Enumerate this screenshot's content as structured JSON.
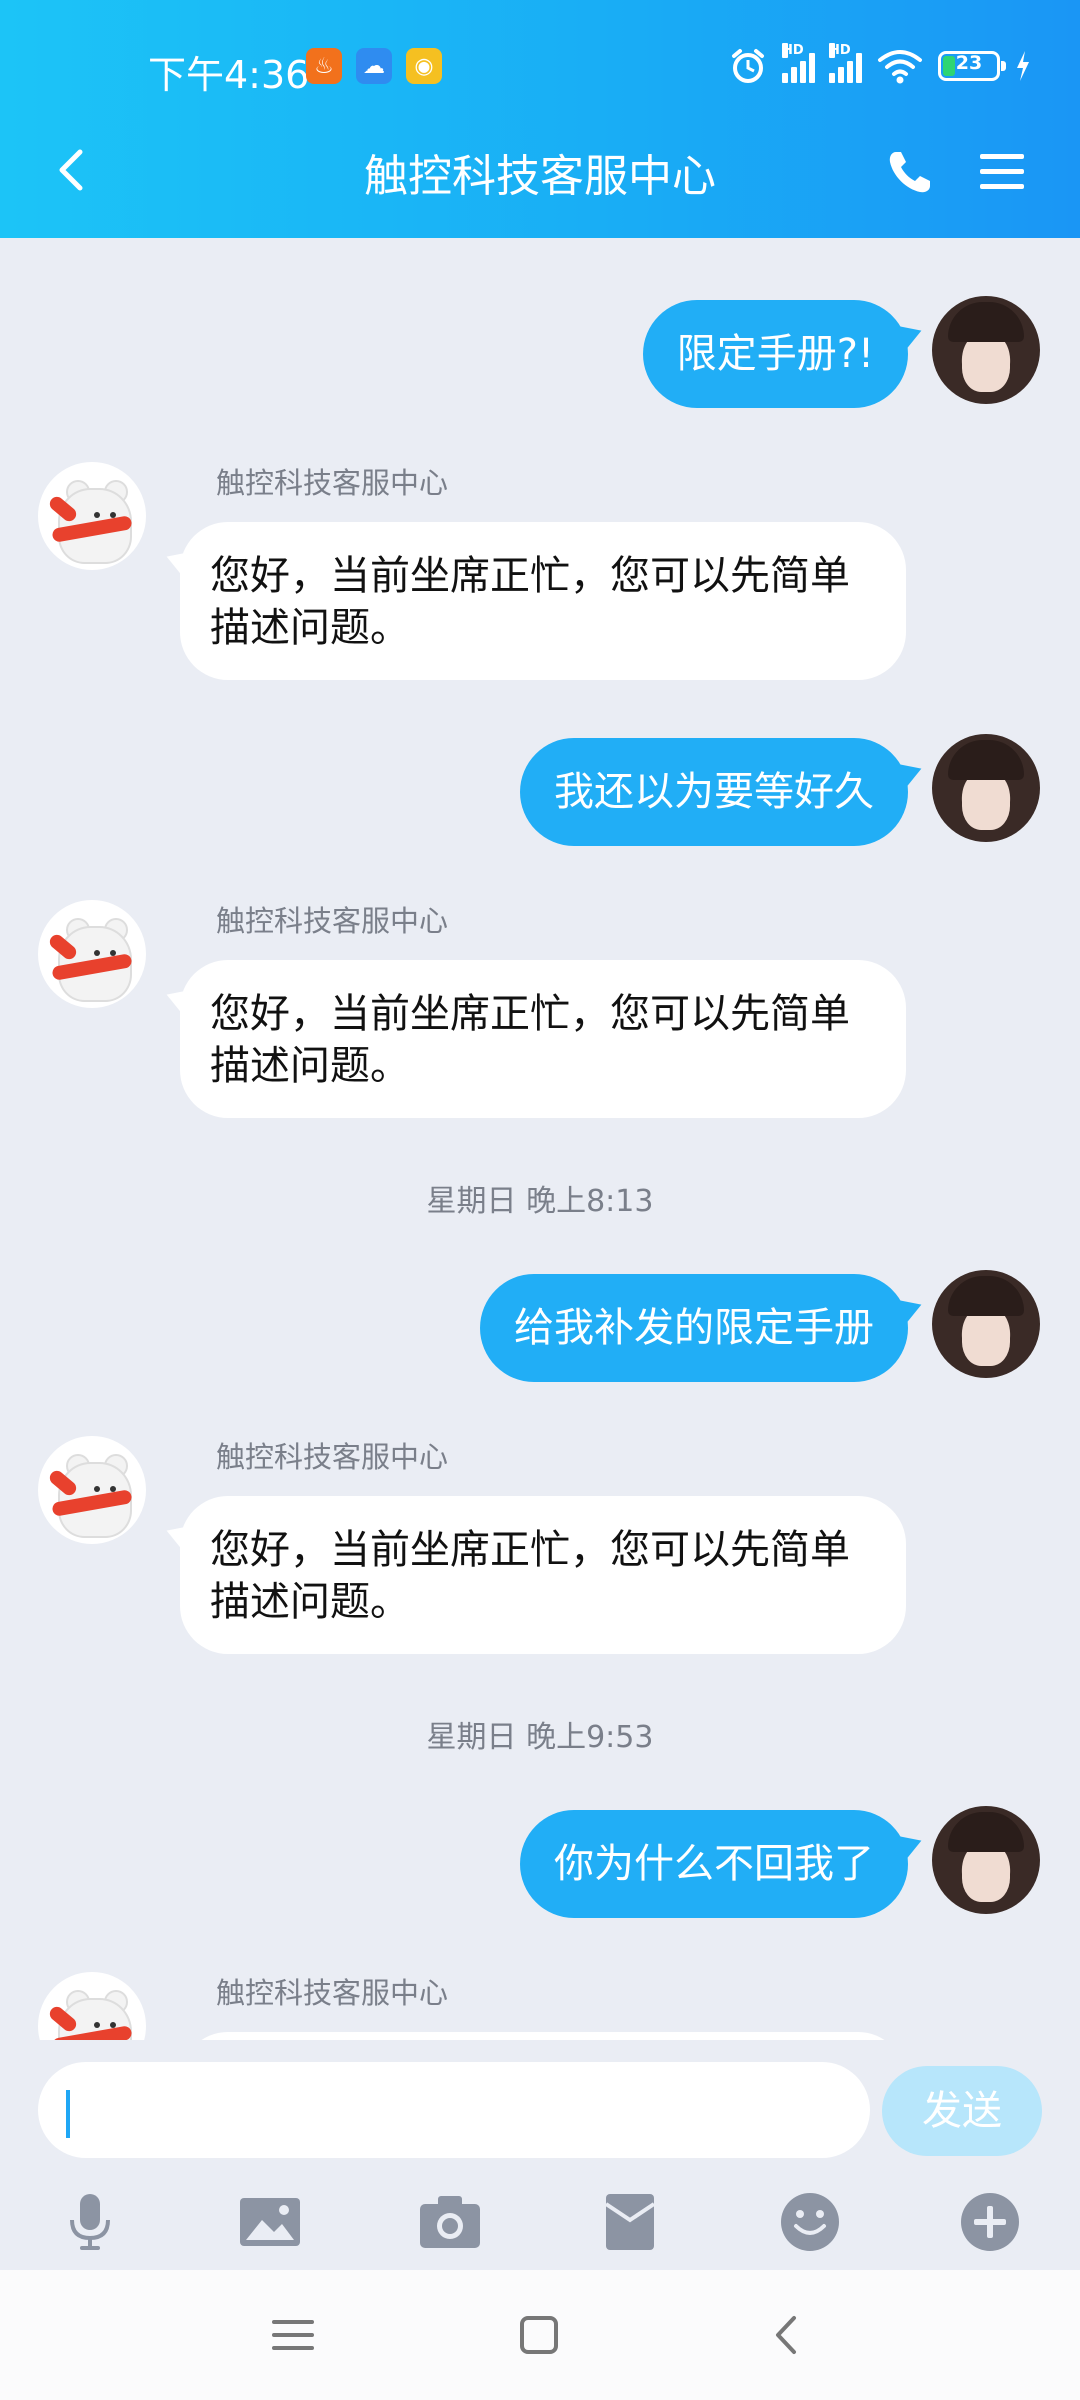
{
  "status_bar": {
    "time": "下午4:36",
    "apps": [
      {
        "name": "uc-browser-icon",
        "color": "#f2711c",
        "glyph": "♨"
      },
      {
        "name": "cloud-icon",
        "color": "#2f8cf0",
        "glyph": "☁"
      },
      {
        "name": "weibo-icon",
        "color": "#f5c021",
        "glyph": "◉"
      }
    ],
    "battery_level": "23",
    "signal_label": "HD"
  },
  "header": {
    "title": "触控科技客服中心"
  },
  "messages": [
    {
      "type": "me",
      "text": "限定手册?!"
    },
    {
      "type": "bot",
      "sender": "触控科技客服中心",
      "text": "您好，当前坐席正忙，您可以先简单描述问题。"
    },
    {
      "type": "me",
      "text": "我还以为要等好久"
    },
    {
      "type": "bot",
      "sender": "触控科技客服中心",
      "text": "您好，当前坐席正忙，您可以先简单描述问题。"
    },
    {
      "type": "time",
      "text": "星期日  晚上8:13"
    },
    {
      "type": "me",
      "text": "给我补发的限定手册"
    },
    {
      "type": "bot",
      "sender": "触控科技客服中心",
      "text": "您好，当前坐席正忙，您可以先简单描述问题。"
    },
    {
      "type": "time",
      "text": "星期日  晚上9:53"
    },
    {
      "type": "me",
      "text": "你为什么不回我了"
    },
    {
      "type": "bot",
      "sender": "触控科技客服中心",
      "text": ""
    }
  ],
  "composer": {
    "input_value": "",
    "send_label": "发送"
  },
  "toolbar": [
    "microphone-icon",
    "image-icon",
    "camera-icon",
    "red-packet-icon",
    "emoji-icon",
    "plus-icon"
  ],
  "colors": {
    "header_gradient_start": "#1cc4f7",
    "header_gradient_end": "#1a96f5",
    "my_bubble": "#21aef6",
    "background": "#eaedf4"
  }
}
